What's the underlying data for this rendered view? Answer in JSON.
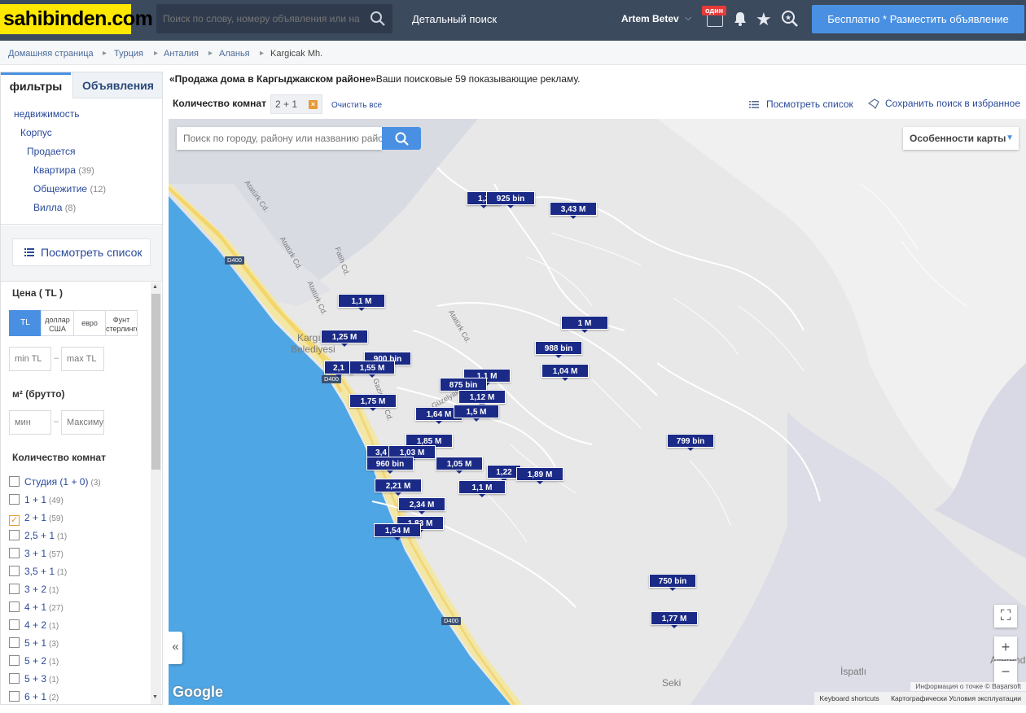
{
  "header": {
    "logo": "sahibinden.com",
    "search_placeholder": "Поиск по слову, номеру объявления или названию",
    "detailed_search": "Детальный поиск",
    "user_name": "Artem Betev",
    "new_badge": "один",
    "post_button": "Бесплатно * Разместить объявление"
  },
  "breadcrumb": [
    "Домашняя страница",
    "Турция",
    "Анталия",
    "Аланья",
    "Kargicak Mh."
  ],
  "sidebar": {
    "tab_filters": "фильтры",
    "tab_listings": "Объявления",
    "categories": [
      {
        "label": "недвижимость",
        "count": ""
      },
      {
        "label": "Корпус",
        "count": ""
      },
      {
        "label": "Продается",
        "count": ""
      },
      {
        "label": "Квартира",
        "count": "(39)"
      },
      {
        "label": "Общежитие",
        "count": "(12)"
      },
      {
        "label": "Вилла",
        "count": "(8)"
      }
    ],
    "view_list": "Посмотреть список",
    "price_title": "Цена ( TL )",
    "currencies": [
      "TL",
      "доллар США",
      "евро",
      "Фунт стерлингов"
    ],
    "price_min_ph": "min TL",
    "price_max_ph": "max TL",
    "area_title": "м² (брутто)",
    "area_min_ph": "мин",
    "area_max_ph": "Максимум",
    "rooms_title": "Количество комнат",
    "rooms": [
      {
        "label": "Студия (1 + 0)",
        "count": "(3)",
        "checked": false
      },
      {
        "label": "1 + 1",
        "count": "(49)",
        "checked": false
      },
      {
        "label": "2 + 1",
        "count": "(59)",
        "checked": true
      },
      {
        "label": "2,5 + 1",
        "count": "(1)",
        "checked": false
      },
      {
        "label": "3 + 1",
        "count": "(57)",
        "checked": false
      },
      {
        "label": "3,5 + 1",
        "count": "(1)",
        "checked": false
      },
      {
        "label": "3 + 2",
        "count": "(1)",
        "checked": false
      },
      {
        "label": "4 + 1",
        "count": "(27)",
        "checked": false
      },
      {
        "label": "4 + 2",
        "count": "(1)",
        "checked": false
      },
      {
        "label": "5 + 1",
        "count": "(3)",
        "checked": false
      },
      {
        "label": "5 + 2",
        "count": "(1)",
        "checked": false
      },
      {
        "label": "5 + 3",
        "count": "(1)",
        "checked": false
      },
      {
        "label": "6 + 1",
        "count": "(2)",
        "checked": false
      }
    ]
  },
  "main": {
    "headline_title": "«Продажа дома в Каргыджакском районе»",
    "headline_text": "Ваши поисковые 59 показывающие рекламу.",
    "rooms_filter_label": "Количество комнат",
    "rooms_chip": "2 + 1",
    "clear_all": "Очистить все",
    "view_list": "Посмотреть список",
    "save_search": "Сохранить поиск в избранное"
  },
  "map": {
    "search_placeholder": "Поиск по городу, району или названию района",
    "features_label": "Особенности карты",
    "streets": [
      "Atatürk Cd.",
      "Atatürk Cd.",
      "Fatih Cd.",
      "Atatürk Cd.",
      "Atatürk Cd.",
      "Güzelyalı Cd.",
      "Gazipaşa Cd."
    ],
    "roads": [
      "D400",
      "D400",
      "D400"
    ],
    "places": [
      "Kargıcak",
      "Belediyesi",
      "Seki",
      "İspatlı",
      "Aliefendi"
    ],
    "prices": [
      "1,2",
      "925 bin",
      "3,43 M",
      "1,1 M",
      "1,25 M",
      "900 bin",
      "2,1",
      "1,55 M",
      "1,1 M",
      "875 bin",
      "1,12 M",
      "1 M",
      "988 bin",
      "1,04 M",
      "1,75 M",
      "1,64 M",
      "1,5 M",
      "1,85 M",
      "3,4",
      "1,03 M",
      "960 bin",
      "1,05 M",
      "1,22",
      "1,89 M",
      "2,21 M",
      "1,1 M",
      "2,34 M",
      "1,83 M",
      "1,54 M",
      "799 bin",
      "750 bin",
      "1,77 M"
    ],
    "google": "Google",
    "attribution": "Информация о точке © Başarsoft",
    "keyboard": "Keyboard shortcuts",
    "terms": "Картографически  Условия эксплуатации"
  },
  "colors": {
    "header_bg": "#3c4a5e",
    "logo_bg": "#ffe800",
    "accent": "#4a90e2",
    "pin": "#1a2a86",
    "sea": "#4fa6e5"
  }
}
